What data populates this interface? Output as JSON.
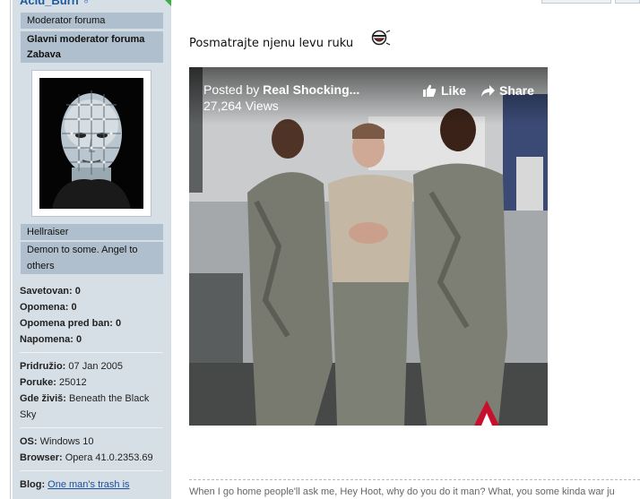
{
  "user": {
    "username": "Acid_Burn",
    "gender_icon": "male-symbol-icon",
    "ranks": [
      "Moderator foruma",
      "Glavni moderator foruma",
      "Zabava"
    ],
    "title_primary": "Hellraiser",
    "title_secondary": "Demon to some. Angel to others"
  },
  "stats": {
    "savetovan_label": "Savetovan:",
    "savetovan_value": "0",
    "opomena_label": "Opomena:",
    "opomena_value": "0",
    "opomena_ban_label": "Opomena pred ban:",
    "opomena_ban_value": "0",
    "napomena_label": "Napomena:",
    "napomena_value": "0"
  },
  "profile": {
    "joined_label": "Pridružio:",
    "joined_value": "07 Jan 2005",
    "posts_label": "Poruke:",
    "posts_value": "25012",
    "location_label": "Gde živiš:",
    "location_value": "Beneath the Black Sky",
    "os_label": "OS:",
    "os_value": "Windows 10",
    "browser_label": "Browser:",
    "browser_value": "Opera 41.0.2353.69",
    "blog_label": "Blog:",
    "blog_link": "One man's trash is"
  },
  "post": {
    "text": "Posmatrajte njenu levu ruku",
    "smiley_icon": "laughing-smiley-icon"
  },
  "video": {
    "posted_prefix": "Posted by",
    "posted_by": "Real Shocking...",
    "views": "27,264 Views",
    "like_label": "Like",
    "share_label": "Share"
  },
  "signature": {
    "text": "When I go home people'll ask me, Hey Hoot, why do you do it man? What, you some kinda war ju"
  },
  "colors": {
    "sidebar_bg": "#d7dfe6",
    "rank_bg": "#afbfcd",
    "link": "#1e4f9a",
    "accent_green": "#35b244"
  }
}
